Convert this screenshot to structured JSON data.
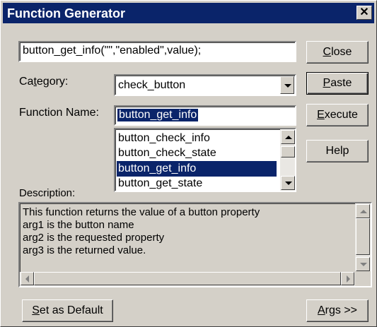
{
  "window": {
    "title": "Function Generator",
    "close_glyph": "✕"
  },
  "function_call": {
    "value": "button_get_info(\"\",\"enabled\",value);"
  },
  "category": {
    "label_pre": "Ca",
    "label_u": "t",
    "label_post": "egory:",
    "selected": "check_button"
  },
  "function_name": {
    "label": "Function Name:",
    "value": "button_get_info"
  },
  "function_list": {
    "items": [
      "button_check_info",
      "button_check_state",
      "button_get_info",
      "button_get_state"
    ],
    "selected_index": 2
  },
  "description": {
    "label": "Description:",
    "lines": [
      "This function returns the value of a button property",
      " arg1 is the button name",
      " arg2 is the requested property",
      " arg3 is the returned value."
    ]
  },
  "buttons": {
    "close": {
      "u": "C",
      "rest": "lose"
    },
    "paste": {
      "u": "P",
      "rest": "aste"
    },
    "execute": {
      "u": "E",
      "rest": "xecute"
    },
    "help": {
      "label": "Help"
    },
    "set_default": {
      "u": "S",
      "rest": "et as Default"
    },
    "args": {
      "u": "A",
      "rest": "rgs >>"
    }
  },
  "colors": {
    "face": "#d4d0c8",
    "title_bg": "#0a246a",
    "selection": "#0a246a"
  },
  "icons": [
    "close-icon",
    "dropdown-arrow-icon",
    "scroll-up-icon",
    "scroll-down-icon",
    "scroll-left-icon",
    "scroll-right-icon"
  ]
}
